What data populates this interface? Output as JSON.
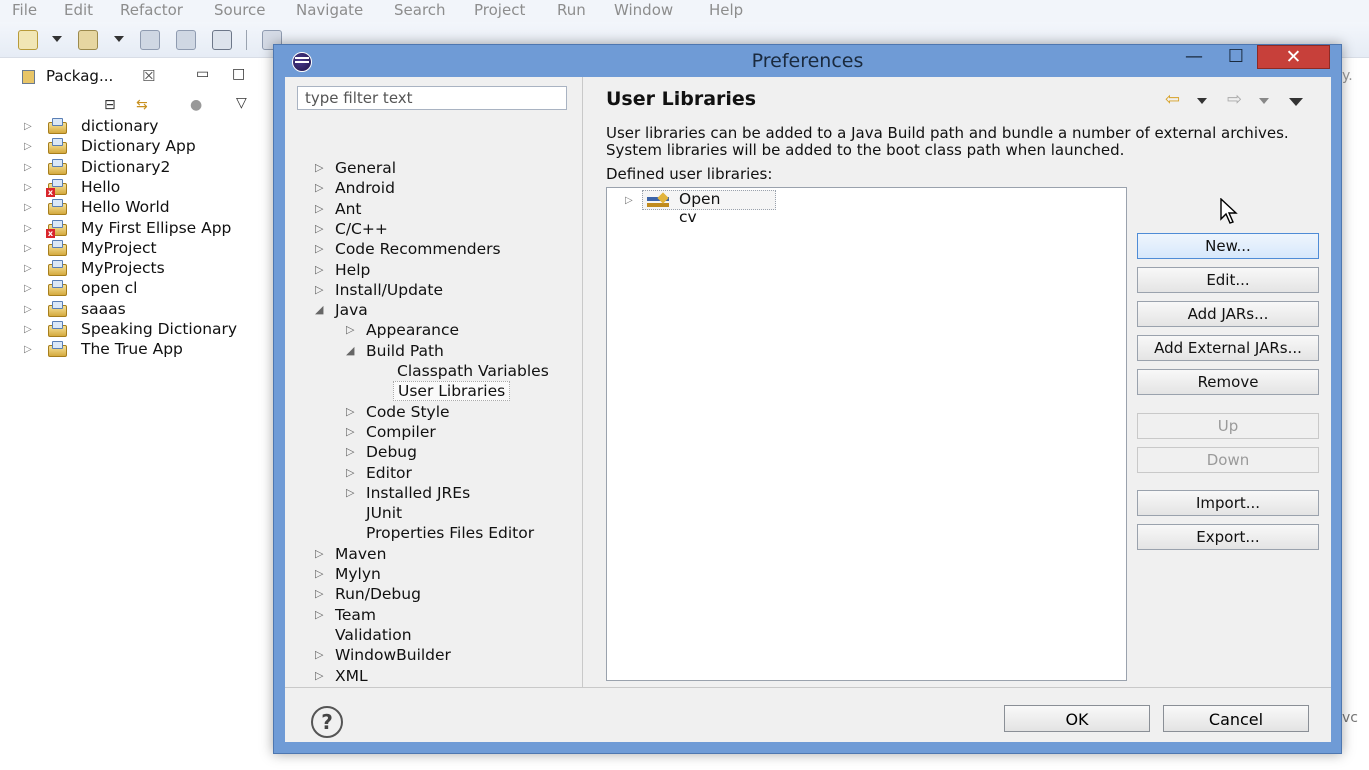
{
  "menubar": {
    "items": [
      "File",
      "Edit",
      "Refactor",
      "Source",
      "Navigate",
      "Search",
      "Project",
      "Run",
      "Window",
      "Help"
    ]
  },
  "package_explorer": {
    "tab_label": "Packag...",
    "tab_close": "☒",
    "projects": [
      {
        "name": "dictionary",
        "error": false
      },
      {
        "name": "Dictionary App",
        "error": false
      },
      {
        "name": "Dictionary2",
        "error": false
      },
      {
        "name": "Hello",
        "error": true
      },
      {
        "name": "Hello World",
        "error": false
      },
      {
        "name": "My First Ellipse App",
        "error": true
      },
      {
        "name": "MyProject",
        "error": false
      },
      {
        "name": "MyProjects",
        "error": false
      },
      {
        "name": "open cl",
        "error": false
      },
      {
        "name": "saaas",
        "error": false
      },
      {
        "name": "Speaking Dictionary",
        "error": false
      },
      {
        "name": "The True App",
        "error": false
      }
    ]
  },
  "background_fragments": {
    "top_right": "y.",
    "bottom_right": "vc"
  },
  "dialog": {
    "title": "Preferences",
    "minimize_glyph": "—",
    "maximize_glyph": "☐",
    "close_glyph": "✕",
    "filter_placeholder": "type filter text",
    "tree": [
      {
        "label": "General",
        "level": 0,
        "twisty": "▷"
      },
      {
        "label": "Android",
        "level": 0,
        "twisty": "▷"
      },
      {
        "label": "Ant",
        "level": 0,
        "twisty": "▷"
      },
      {
        "label": "C/C++",
        "level": 0,
        "twisty": "▷"
      },
      {
        "label": "Code Recommenders",
        "level": 0,
        "twisty": "▷"
      },
      {
        "label": "Help",
        "level": 0,
        "twisty": "▷"
      },
      {
        "label": "Install/Update",
        "level": 0,
        "twisty": "▷"
      },
      {
        "label": "Java",
        "level": 0,
        "twisty": "◢"
      },
      {
        "label": "Appearance",
        "level": 1,
        "twisty": "▷"
      },
      {
        "label": "Build Path",
        "level": 1,
        "twisty": "◢"
      },
      {
        "label": "Classpath Variables",
        "level": 2,
        "twisty": ""
      },
      {
        "label": "User Libraries",
        "level": 2,
        "twisty": "",
        "selected": true
      },
      {
        "label": "Code Style",
        "level": 1,
        "twisty": "▷"
      },
      {
        "label": "Compiler",
        "level": 1,
        "twisty": "▷"
      },
      {
        "label": "Debug",
        "level": 1,
        "twisty": "▷"
      },
      {
        "label": "Editor",
        "level": 1,
        "twisty": "▷"
      },
      {
        "label": "Installed JREs",
        "level": 1,
        "twisty": "▷"
      },
      {
        "label": "JUnit",
        "level": 1,
        "twisty": ""
      },
      {
        "label": "Properties Files Editor",
        "level": 1,
        "twisty": ""
      },
      {
        "label": "Maven",
        "level": 0,
        "twisty": "▷"
      },
      {
        "label": "Mylyn",
        "level": 0,
        "twisty": "▷"
      },
      {
        "label": "Run/Debug",
        "level": 0,
        "twisty": "▷"
      },
      {
        "label": "Team",
        "level": 0,
        "twisty": "▷"
      },
      {
        "label": "Validation",
        "level": 0,
        "twisty": ""
      },
      {
        "label": "WindowBuilder",
        "level": 0,
        "twisty": "▷"
      },
      {
        "label": "XML",
        "level": 0,
        "twisty": "▷"
      }
    ],
    "page": {
      "title": "User Libraries",
      "description": "User libraries can be added to a Java Build path and bundle a number of external archives. System libraries will be added to the boot class path when launched.",
      "defined_label": "Defined user libraries:",
      "libraries": [
        {
          "name": "Open cv"
        }
      ],
      "buttons": {
        "new": "New...",
        "edit": "Edit...",
        "add_jars": "Add JARs...",
        "add_external_jars": "Add External JARs...",
        "remove": "Remove",
        "up": "Up",
        "down": "Down",
        "import": "Import...",
        "export": "Export..."
      }
    },
    "footer": {
      "help": "?",
      "ok": "OK",
      "cancel": "Cancel"
    }
  },
  "colors": {
    "dialog_frame": "#6f9bd6",
    "close_button": "#c7403a",
    "dialog_body": "#f0f0f0"
  }
}
